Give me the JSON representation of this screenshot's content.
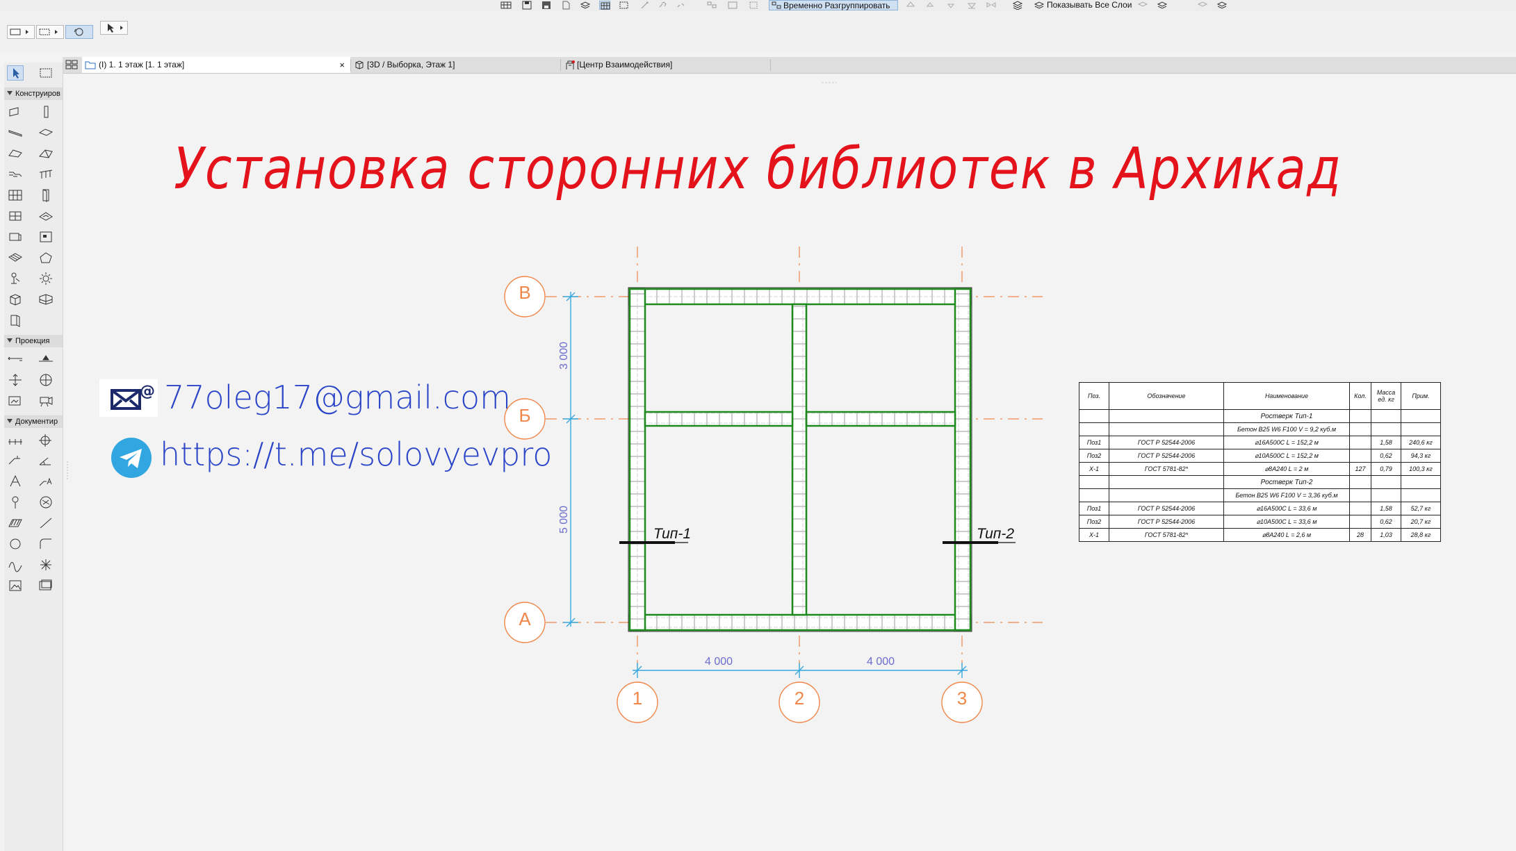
{
  "toolbar": {
    "regroup_label": "Временно Разгруппировать",
    "show_layers_label": "Показывать Все Слои"
  },
  "tabs": [
    {
      "label": "(I) 1. 1 этаж [1. 1 этаж]"
    },
    {
      "label": "[3D / Выборка, Этаж 1]"
    },
    {
      "label": "[Центр Взаимодействия]"
    }
  ],
  "palette": {
    "section_design": "Конструиров",
    "section_projection": "Проекция",
    "section_documentation": "Документир"
  },
  "drawing": {
    "title": "Установка сторонних библиотек в Архикад",
    "email": "77oleg17@gmail.com",
    "telegram": "https://t.me/solovyevpro",
    "axes_letters": [
      "В",
      "Б",
      "А"
    ],
    "axes_numbers": [
      "1",
      "2",
      "3"
    ],
    "dim_vertical": [
      "3 000",
      "5 000"
    ],
    "dim_horizontal": [
      "4 000",
      "4 000"
    ],
    "section_labels": [
      "Тип-1",
      "Тип-2"
    ],
    "colors": {
      "title": "#e3121b",
      "contact": "#2b45c8",
      "axis": "#f0874a",
      "dimension": "#35a7e0",
      "beam": "#1e8a1e"
    }
  },
  "schedule": {
    "headers": [
      "Поз.",
      "Обозначение",
      "Наименование",
      "Кол.",
      "Масса ед. кг",
      "Прим."
    ],
    "groups": [
      {
        "title": "Ростверк Тип-1",
        "subtitle": "Бетон B25 W6 F100   V = 9,2 куб.м",
        "rows": [
          [
            "Поз1",
            "ГОСТ Р 52544-2006",
            "⌀16А500С      L = 152,2 м",
            "",
            "1,58",
            "240,6 кг"
          ],
          [
            "Поз2",
            "ГОСТ Р 52544-2006",
            "⌀10А500С      L = 152,2 м",
            "",
            "0,62",
            "94,3 кг"
          ],
          [
            "Х-1",
            "ГОСТ 5781-82*",
            "⌀8А240        L = 2 м",
            "127",
            "0,79",
            "100,3 кг"
          ]
        ]
      },
      {
        "title": "Ростверк Тип-2",
        "subtitle": "Бетон B25 W6 F100   V = 3,36 куб.м",
        "rows": [
          [
            "Поз1",
            "ГОСТ Р 52544-2006",
            "⌀16А500С      L = 33,6 м",
            "",
            "1,58",
            "52,7 кг"
          ],
          [
            "Поз2",
            "ГОСТ Р 52544-2006",
            "⌀10А500С      L = 33,6 м",
            "",
            "0,62",
            "20,7 кг"
          ],
          [
            "Х-1",
            "ГОСТ 5781-82*",
            "⌀8А240        L = 2,6 м",
            "28",
            "1,03",
            "28,8 кг"
          ]
        ]
      }
    ]
  }
}
